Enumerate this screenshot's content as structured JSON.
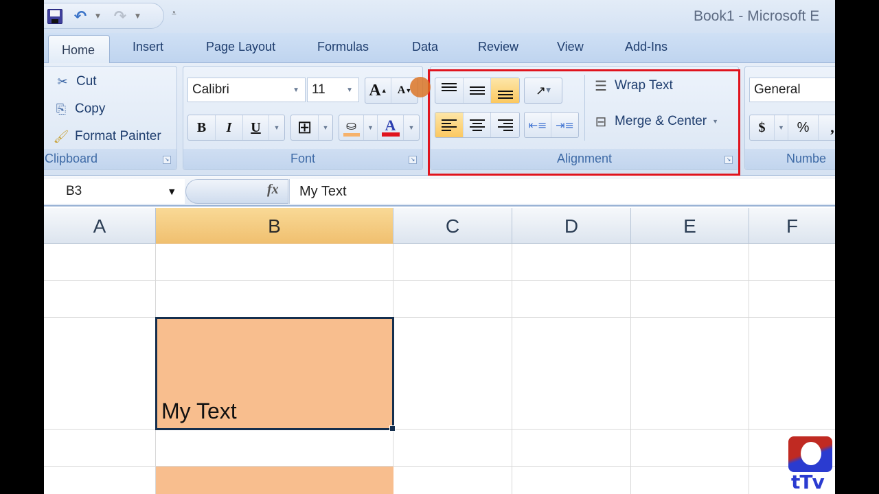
{
  "window": {
    "title": "Book1 - Microsoft E"
  },
  "quick_access": {
    "save": "save-icon",
    "undo": "undo-icon",
    "redo": "redo-icon",
    "customize": "customize-qat-icon"
  },
  "tabs": [
    {
      "label": "Home",
      "active": true
    },
    {
      "label": "Insert",
      "active": false
    },
    {
      "label": "Page Layout",
      "active": false
    },
    {
      "label": "Formulas",
      "active": false
    },
    {
      "label": "Data",
      "active": false
    },
    {
      "label": "Review",
      "active": false
    },
    {
      "label": "View",
      "active": false
    },
    {
      "label": "Add-Ins",
      "active": false
    }
  ],
  "ribbon": {
    "clipboard": {
      "label": "Clipboard",
      "cut": "Cut",
      "copy": "Copy",
      "format_painter": "Format Painter"
    },
    "font": {
      "label": "Font",
      "font_name": "Calibri",
      "font_size": "11",
      "grow": "A",
      "shrink": "A",
      "bold": "B",
      "italic": "I",
      "underline": "U",
      "font_color_letter": "A",
      "fill_color": "#f6b26b",
      "font_color": "#e0141e"
    },
    "alignment": {
      "label": "Alignment",
      "wrap_text": "Wrap Text",
      "merge_center": "Merge & Center",
      "active_vertical": "bottom",
      "active_horizontal": "left"
    },
    "number": {
      "label": "Numbe",
      "format": "General",
      "currency": "$",
      "percent": "%",
      "comma": ","
    }
  },
  "formula_bar": {
    "name_box": "B3",
    "fx": "fx",
    "value": "My Text"
  },
  "sheet": {
    "columns": [
      "A",
      "B",
      "C",
      "D",
      "E",
      "F"
    ],
    "selected_column": "B",
    "active_cell": "B3",
    "active_cell_value": "My Text",
    "fill_color": "#f8be8e"
  },
  "logo": {
    "text": "tTv"
  }
}
